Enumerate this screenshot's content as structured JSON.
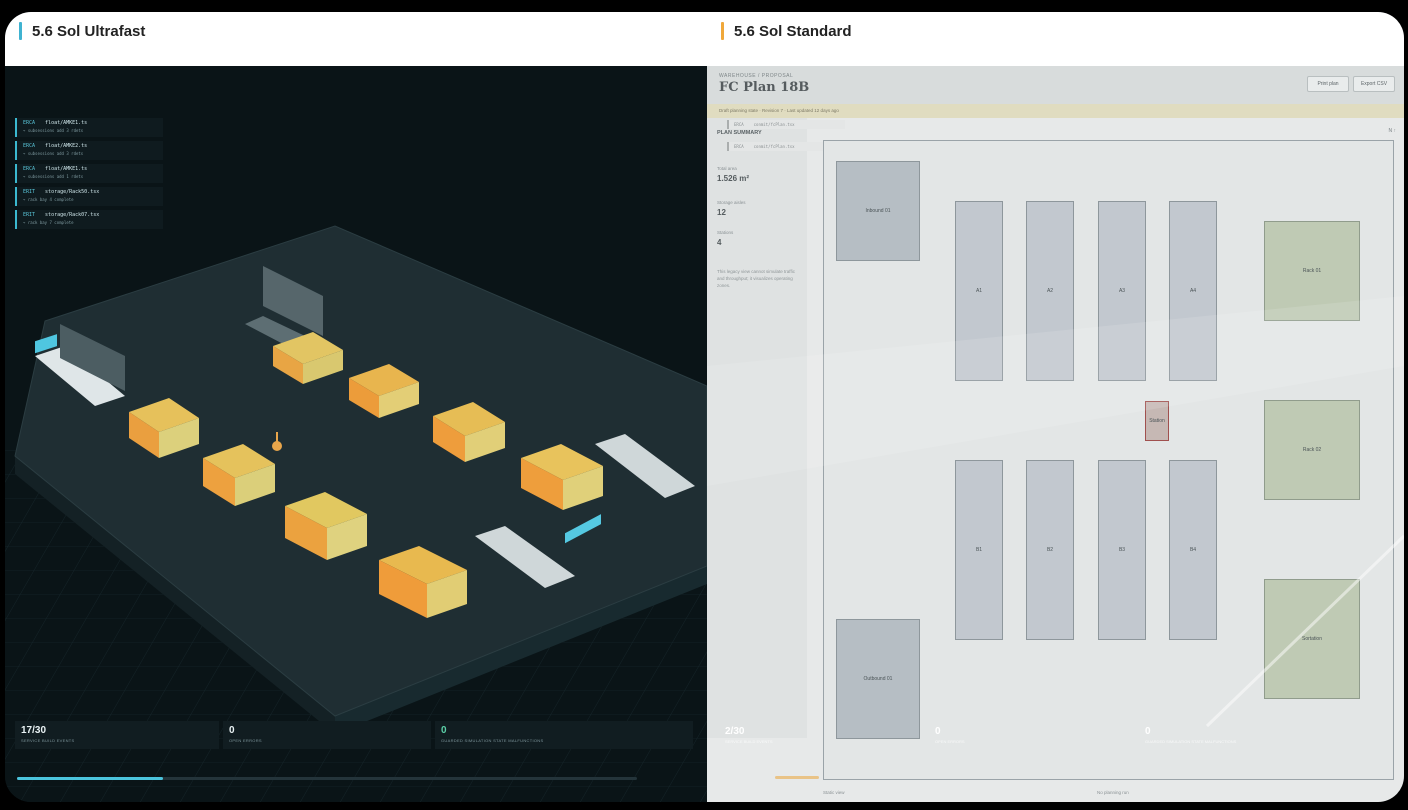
{
  "panels": {
    "left_title": "5.6 Sol Ultrafast",
    "right_title": "5.6 Sol Standard",
    "left_accent": "#3fb3d1",
    "right_accent": "#f0a83a"
  },
  "left": {
    "logs": [
      {
        "op": "ERCA",
        "file": "float/AMKE1.ts",
        "detail": "→ subsessions add 3 rdets"
      },
      {
        "op": "ERCA",
        "file": "float/AMKE2.ts",
        "detail": "→ subsessions add 3 rdets"
      },
      {
        "op": "ERCA",
        "file": "float/AMKE1.ts",
        "detail": "→ subsessions add 1 rdets"
      },
      {
        "op": "ERIT",
        "file": "storage/Rack50.tsx",
        "detail": "→ rack bay 4 complete"
      },
      {
        "op": "ERIT",
        "file": "storage/Rack07.tsx",
        "detail": "→ rack bay 7 complete"
      }
    ],
    "stats": [
      {
        "value": "17/30",
        "label": "SERVICE BUILD EVENTS"
      },
      {
        "value": "0",
        "label": "OPEN ERRORS"
      },
      {
        "value": "0",
        "label": "GUARDED SIMULATION STATE MALFUNCTIONS"
      }
    ],
    "progress": 0.235
  },
  "right": {
    "eyebrow": "WAREHOUSE / PROPOSAL",
    "title": "FC Plan 18B",
    "buttons": {
      "print": "Print plan",
      "export": "Export CSV"
    },
    "notice": "Draft planning state · Revision 7 · Last updated 12 days ago",
    "summary": {
      "heading": "PLAN SUMMARY",
      "total_area_label": "Total area",
      "total_area": "1.526 m²",
      "storage_aisles_label": "Storage aisles",
      "storage_aisles": "12",
      "stations_label": "Stations",
      "stations": "4",
      "note": "This legacy view cannot simulate traffic and throughput; it visualizes operating zones."
    },
    "commands": [
      {
        "op": "ERCA",
        "file": "conmit/fcPlan.tsx"
      },
      {
        "op": "ERCA",
        "file": "conmit/fcPlan.tsx"
      }
    ],
    "plan_corner": "N ↑",
    "zones": {
      "inbound": "Inbound 01",
      "outbound": "Outbound 01",
      "aisles_top": [
        "A1",
        "A2",
        "A3",
        "A4"
      ],
      "aisles_bottom": [
        "B1",
        "B2",
        "B3",
        "B4"
      ],
      "station": "Station",
      "rack_1": "Rack 01",
      "rack_2": "Rack 02",
      "sortation": "Sortation"
    },
    "stats": [
      {
        "value": "2/30",
        "label": "SERVICE BUILD EVENTS"
      },
      {
        "value": "0",
        "label": "OPEN ERRORS"
      },
      {
        "value": "0",
        "label": "GUARDED SIMULATION STATE MALFUNCTIONS"
      }
    ],
    "footer": {
      "left": "Static view",
      "mid": "No planning run"
    }
  }
}
